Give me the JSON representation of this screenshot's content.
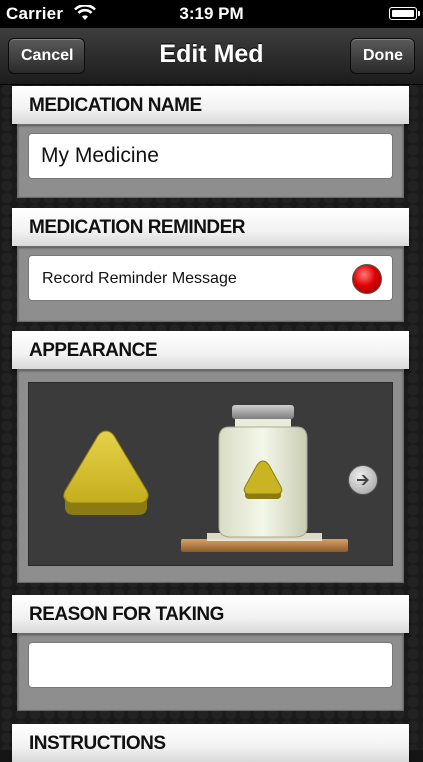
{
  "status_bar": {
    "carrier": "Carrier",
    "time": "3:19 PM"
  },
  "nav": {
    "title": "Edit Med",
    "cancel_label": "Cancel",
    "done_label": "Done"
  },
  "sections": {
    "medication_name": {
      "header": "MEDICATION NAME",
      "value": "My Medicine"
    },
    "medication_reminder": {
      "header": "MEDICATION REMINDER",
      "record_label": "Record Reminder Message"
    },
    "appearance": {
      "header": "APPEARANCE",
      "pill_color": "#c8b52a",
      "pill_shape": "triangle"
    },
    "reason": {
      "header": "REASON FOR TAKING",
      "value": ""
    },
    "instructions": {
      "header": "INSTRUCTIONS"
    }
  },
  "colors": {
    "record_dot": "#e00000",
    "pill": "#c8b52a"
  }
}
